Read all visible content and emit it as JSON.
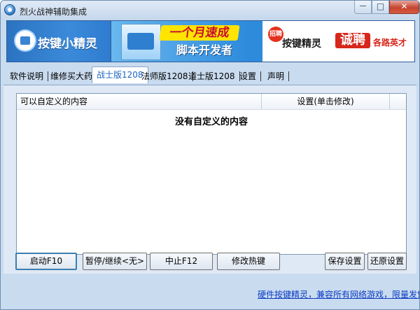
{
  "window": {
    "title": "烈火战神辅助集成"
  },
  "title_buttons": {
    "minimize": "－",
    "maximize": "□",
    "close": "✕"
  },
  "banner": {
    "logo_text": "按键小精灵",
    "ad_line1": "一个月速成",
    "ad_line2": "脚本开发者",
    "hiring_badge": "招聘",
    "hiring_brand": "按键精灵",
    "hiring_big": "诚聘",
    "hiring_sub": "各路英才"
  },
  "tabs": [
    {
      "label": "软件说明"
    },
    {
      "label": "维修买大药"
    },
    {
      "label": "战士版1208"
    },
    {
      "label": "法师版1208"
    },
    {
      "label": "道士版1208"
    },
    {
      "label": "设置"
    },
    {
      "label": "声明"
    }
  ],
  "active_tab": "战士版1208",
  "list": {
    "columns": [
      "可以自定义的内容",
      "设置(单击修改)"
    ],
    "empty_message": "没有自定义的内容"
  },
  "buttons": {
    "start": "启动F10",
    "pause": "暂停/继续<无>",
    "stop": "中止F12",
    "hotkey": "修改热键",
    "save": "保存设置",
    "restore": "还原设置"
  },
  "footer": {
    "link": "硬件按键精灵，兼容所有网络游戏，限量发售"
  },
  "colors": {
    "accent": "#1c63c2",
    "frame": "#c9dbef",
    "link": "#0b3cc4"
  }
}
